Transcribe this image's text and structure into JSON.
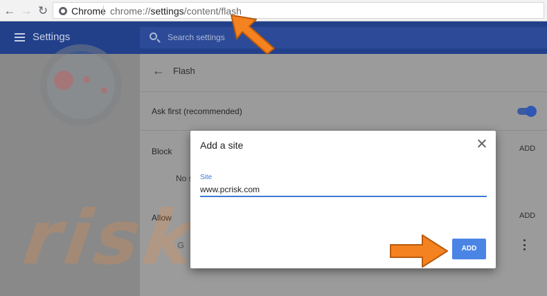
{
  "browser": {
    "site_chip": "Chrome",
    "url_prefix": "chrome://",
    "url_path": "settings",
    "url_suffix": "/content/flash"
  },
  "header": {
    "title": "Settings",
    "search_placeholder": "Search settings"
  },
  "page": {
    "title": "Flash",
    "ask_first_label": "Ask first (recommended)",
    "ask_first_enabled": true,
    "block_label": "Block",
    "block_add": "ADD",
    "no_sites_text": "No s",
    "allow_label": "Allow",
    "allow_add": "ADD",
    "allowed_site_icon": "G"
  },
  "dialog": {
    "title": "Add a site",
    "field_label": "Site",
    "field_value": "www.pcrisk.com",
    "add_button": "ADD"
  },
  "watermark": "risk.com",
  "colors": {
    "accent": "#4a85e6",
    "annotation_arrow": "#f58220",
    "header": "#22408a"
  }
}
